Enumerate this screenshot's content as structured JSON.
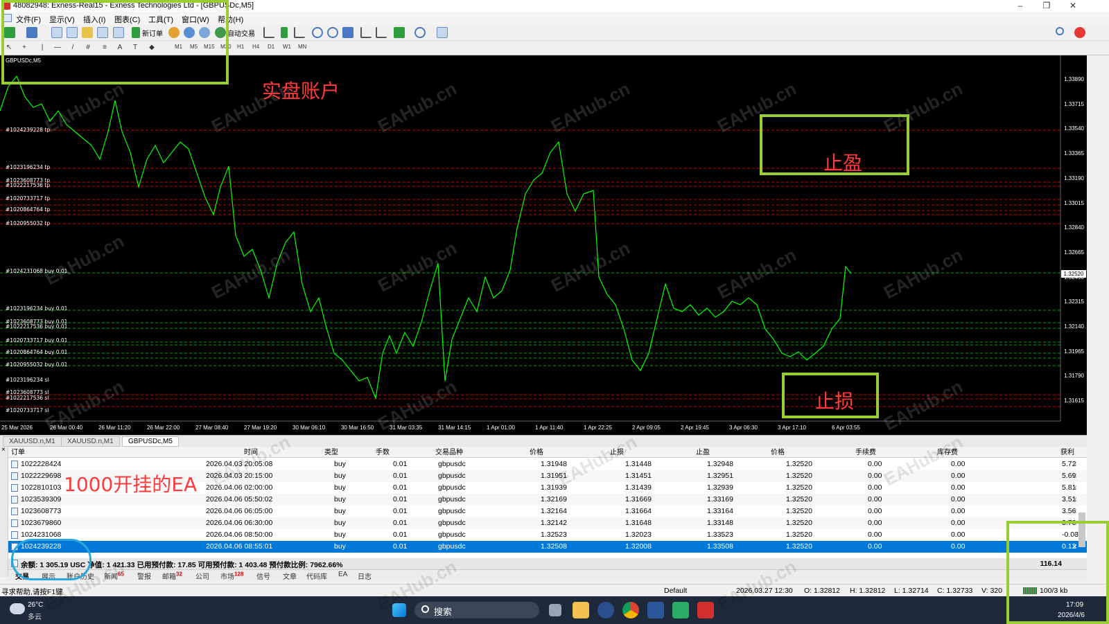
{
  "window": {
    "title": "48082948: Exness-Real15 - Exness Technologies Ltd - [GBPUSDc,M5]",
    "minimize": "–",
    "maximize": "❐",
    "close": "✕"
  },
  "menu": [
    "文件(F)",
    "显示(V)",
    "插入(I)",
    "图表(C)",
    "工具(T)",
    "窗口(W)",
    "帮助(H)"
  ],
  "toolbar": {
    "new_order": "新订单",
    "auto_trade": "自动交易",
    "timeframes": [
      "M1",
      "M5",
      "M15",
      "M30",
      "H1",
      "H4",
      "D1",
      "W1",
      "MN"
    ]
  },
  "chart": {
    "symbol_label": "GBPUSDc,M5",
    "price_axis": [
      "1.33890",
      "1.33715",
      "1.33540",
      "1.33365",
      "1.33190",
      "1.33015",
      "1.32840",
      "1.32665",
      "1.32490",
      "1.32315",
      "1.32140",
      "1.31965",
      "1.31790",
      "1.31615"
    ],
    "current_price": "1.32520",
    "time_axis": [
      "25 Mar 2026",
      "26 Mar 00:40",
      "26 Mar 11:20",
      "26 Mar 22:00",
      "27 Mar 08:40",
      "27 Mar 19:20",
      "30 Mar 06:10",
      "30 Mar 16:50",
      "31 Mar 03:35",
      "31 Mar 14:15",
      "1 Apr 01:00",
      "1 Apr 11:40",
      "1 Apr 22:25",
      "2 Apr 09:05",
      "2 Apr 19:45",
      "3 Apr 06:30",
      "3 Apr 17:10",
      "6 Apr 03:55"
    ],
    "tp_labels": [
      "#1024239228 tp",
      "#1023196234 tp",
      "#1023608773 tp",
      "#1022217536 tp",
      "#1020733717 tp",
      "#1020864764 tp",
      "#1020955032 tp"
    ],
    "buy_labels": [
      "#1024231068 buy 0.01",
      "#1023196234 buy 0.01",
      "#1023608773 buy 0.01",
      "#1022217536 buy 0.01",
      "#1020733717 buy 0.01",
      "#1020864764 buy 0.01",
      "#1020955032 buy 0.01"
    ],
    "sl_labels": [
      "#1023196234 sl",
      "#1023608773 sl",
      "#1022217536 sl",
      "#1020733717 sl"
    ],
    "watermark": "EAHub.cn"
  },
  "annotations": {
    "live_account": "实盘账户",
    "take_profit": "止盈",
    "stop_loss": "止损",
    "ea_start": "1000开挂的EA"
  },
  "chart_tabs": [
    "XAUUSD.n,M1",
    "XAUUSD.n,M1",
    "GBPUSDc,M5"
  ],
  "terminal": {
    "headers": [
      "订单",
      "时间",
      "类型",
      "手数",
      "交易品种",
      "价格",
      "止损",
      "止盈",
      "价格",
      "手续费",
      "库存费",
      "获利"
    ],
    "rows": [
      {
        "order": "1022228424",
        "time": "2026.04.03 20:05:08",
        "type": "buy",
        "lots": "0.01",
        "symbol": "gbpusdc",
        "price": "1.31948",
        "sl": "1.31448",
        "tp": "1.32948",
        "cur": "1.32520",
        "fee": "0.00",
        "swap": "0.00",
        "profit": "5.72"
      },
      {
        "order": "1022229698",
        "time": "2026.04.03 20:15:00",
        "type": "buy",
        "lots": "0.01",
        "symbol": "gbpusdc",
        "price": "1.31951",
        "sl": "1.31451",
        "tp": "1.32951",
        "cur": "1.32520",
        "fee": "0.00",
        "swap": "0.00",
        "profit": "5.69"
      },
      {
        "order": "1022810103",
        "time": "2026.04.06 02:00:00",
        "type": "buy",
        "lots": "0.01",
        "symbol": "gbpusdc",
        "price": "1.31939",
        "sl": "1.31439",
        "tp": "1.32939",
        "cur": "1.32520",
        "fee": "0.00",
        "swap": "0.00",
        "profit": "5.81"
      },
      {
        "order": "1023539309",
        "time": "2026.04.06 05:50:02",
        "type": "buy",
        "lots": "0.01",
        "symbol": "gbpusdc",
        "price": "1.32169",
        "sl": "1.31669",
        "tp": "1.33169",
        "cur": "1.32520",
        "fee": "0.00",
        "swap": "0.00",
        "profit": "3.51"
      },
      {
        "order": "1023608773",
        "time": "2026.04.06 06:05:00",
        "type": "buy",
        "lots": "0.01",
        "symbol": "gbpusdc",
        "price": "1.32164",
        "sl": "1.31664",
        "tp": "1.33164",
        "cur": "1.32520",
        "fee": "0.00",
        "swap": "0.00",
        "profit": "3.56"
      },
      {
        "order": "1023679860",
        "time": "2026.04.06 06:30:00",
        "type": "buy",
        "lots": "0.01",
        "symbol": "gbpusdc",
        "price": "1.32142",
        "sl": "1.31648",
        "tp": "1.33148",
        "cur": "1.32520",
        "fee": "0.00",
        "swap": "0.00",
        "profit": "3.78"
      },
      {
        "order": "1024231068",
        "time": "2026.04.06 08:50:00",
        "type": "buy",
        "lots": "0.01",
        "symbol": "gbpusdc",
        "price": "1.32523",
        "sl": "1.32023",
        "tp": "1.33523",
        "cur": "1.32520",
        "fee": "0.00",
        "swap": "0.00",
        "profit": "-0.03"
      },
      {
        "order": "1024239228",
        "time": "2026.04.06 08:55:01",
        "type": "buy",
        "lots": "0.01",
        "symbol": "gbpusdc",
        "price": "1.32508",
        "sl": "1.32008",
        "tp": "1.33508",
        "cur": "1.32520",
        "fee": "0.00",
        "swap": "0.00",
        "profit": "0.12"
      }
    ],
    "balance_text": "余额: 1 305.19 USC  净值: 1 421.33  已用预付款: 17.85  可用预付款: 1 403.48  预付款比例: 7962.66%",
    "total_profit": "116.14",
    "tabs": [
      {
        "label": "交易"
      },
      {
        "label": "展示"
      },
      {
        "label": "账户历史"
      },
      {
        "label": "新闻",
        "badge": "65"
      },
      {
        "label": "警报"
      },
      {
        "label": "邮箱",
        "badge": "32"
      },
      {
        "label": "公司"
      },
      {
        "label": "市场",
        "badge": "128"
      },
      {
        "label": "信号"
      },
      {
        "label": "文章"
      },
      {
        "label": "代码库"
      },
      {
        "label": "EA"
      },
      {
        "label": "日志"
      }
    ]
  },
  "statusbar": {
    "help": "寻求帮助,请按F1键",
    "profile": "Default",
    "datetime": "2026.03.27 12:30",
    "open": "O: 1.32812",
    "high": "H: 1.32812",
    "low": "L: 1.32714",
    "close": "C: 1.32733",
    "volume": "V: 320",
    "traffic": "100/3 kb"
  },
  "taskbar": {
    "weather_temp": "26°C",
    "weather_desc": "多云",
    "search": "搜索",
    "time": "17:09",
    "date": "2026/4/6"
  },
  "colors": {
    "candle": "#00ff00",
    "tp_line": "#cc0000",
    "buy_line": "#00aa00",
    "annotation_box": "#9acd32",
    "annotation_text": "#ff3b3b",
    "selected_row": "#0078d7"
  }
}
